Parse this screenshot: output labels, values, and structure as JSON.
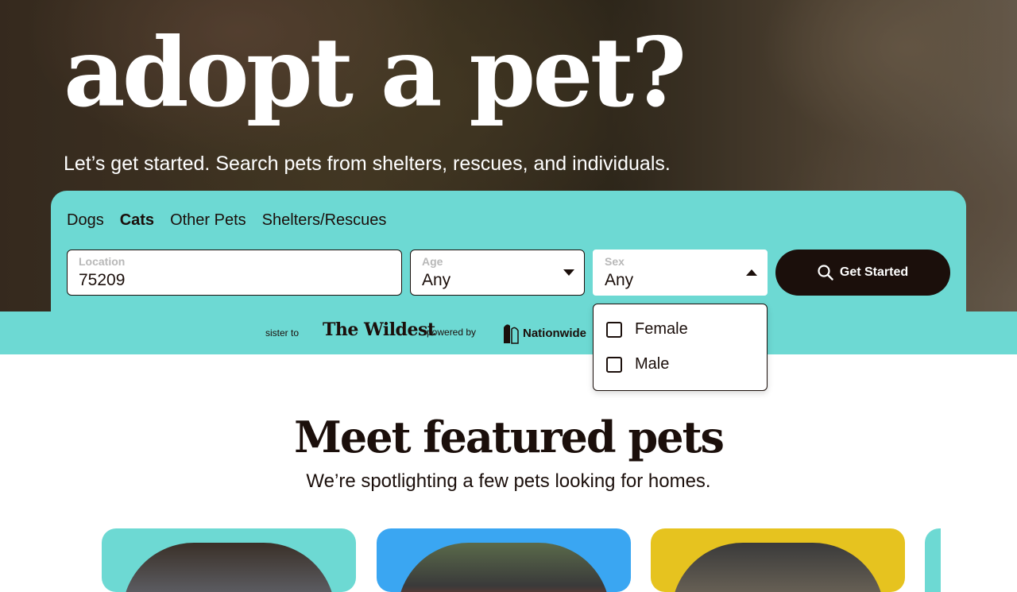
{
  "hero": {
    "title": "adopt a pet?",
    "subtitle": "Let’s get started. Search pets from shelters, rescues, and individuals."
  },
  "search": {
    "tabs": [
      {
        "label": "Dogs",
        "active": false
      },
      {
        "label": "Cats",
        "active": true
      },
      {
        "label": "Other Pets",
        "active": false
      },
      {
        "label": "Shelters/Rescues",
        "active": false
      }
    ],
    "location": {
      "label": "Location",
      "value": "75209"
    },
    "age": {
      "label": "Age",
      "value": "Any"
    },
    "sex": {
      "label": "Sex",
      "value": "Any",
      "options": [
        "Female",
        "Male"
      ]
    },
    "submit_label": "Get Started"
  },
  "sponsors": {
    "sister_text": "sister to",
    "wildest_logo": "The Wildest",
    "powered_text": "powered by",
    "nationwide_logo": "Nationwide"
  },
  "featured": {
    "title": "Meet featured pets",
    "subtitle": "We’re spotlighting a few pets looking for homes."
  },
  "colors": {
    "teal": "#6dd9d3",
    "dark": "#1b0f0b",
    "blue": "#3aa6f2",
    "yellow": "#e6c31f"
  }
}
